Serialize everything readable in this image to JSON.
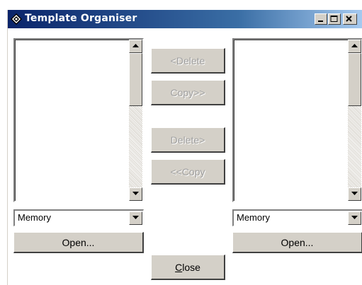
{
  "window": {
    "title": "Template Organiser",
    "title_bar_colors": [
      "#0a246a",
      "#3a6ea5",
      "#a6caf0"
    ],
    "controls": [
      "minimize-icon",
      "maximize-icon",
      "close-icon"
    ]
  },
  "left_panel": {
    "items": [],
    "combo_value": "Memory",
    "open_label": "Open..."
  },
  "right_panel": {
    "items": [],
    "combo_value": "Memory",
    "open_label": "Open..."
  },
  "buttons": {
    "delete_left": "<Delete",
    "copy_right": "Copy>>",
    "delete_right": "Delete>",
    "copy_left": "<<Copy",
    "close_prefix": "",
    "close_mnemonic": "C",
    "close_rest": "lose"
  },
  "colors": {
    "button_face": "#d4d0c8",
    "disabled_text": "#a0a0a0"
  }
}
